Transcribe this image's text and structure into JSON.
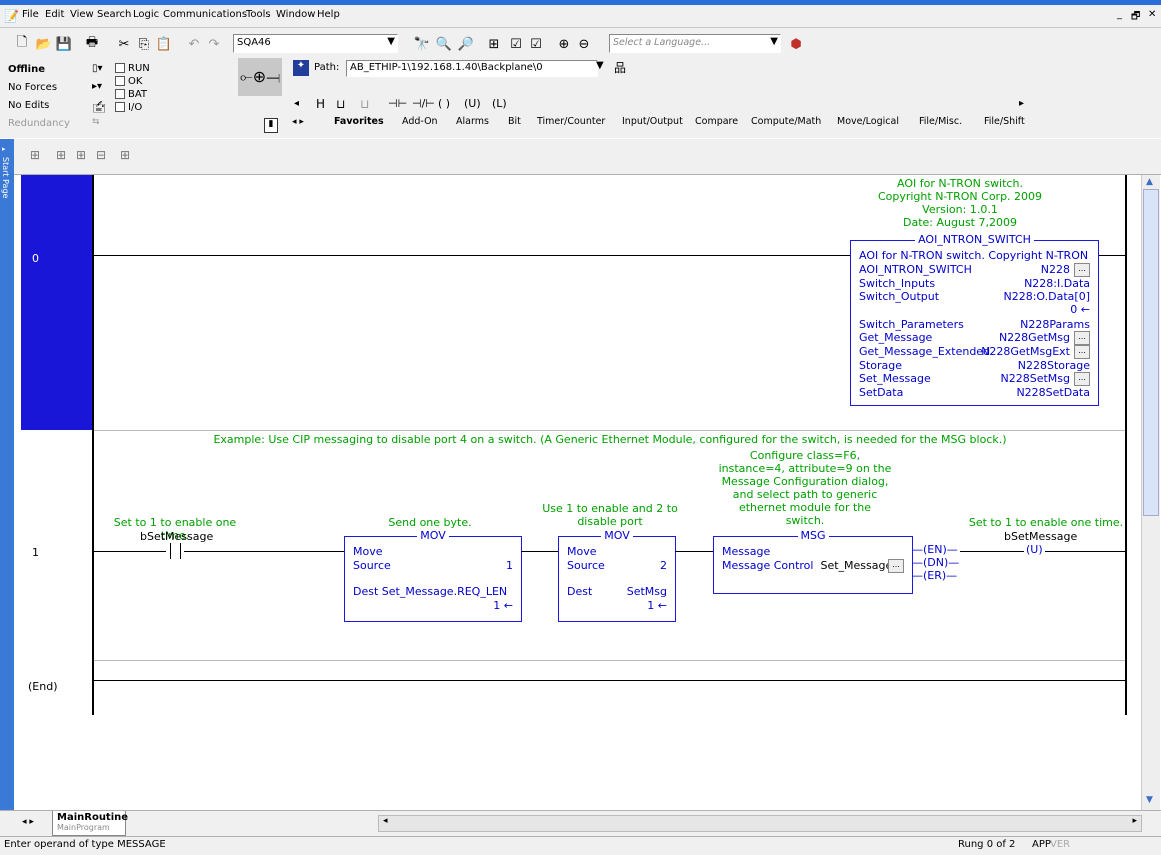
{
  "menu": [
    "File",
    "Edit",
    "View",
    "Search",
    "Logic",
    "Communications",
    "Tools",
    "Window",
    "Help"
  ],
  "window_controls": [
    "_",
    "🗗",
    "✕"
  ],
  "toolbar": {
    "project_field": "SQA46",
    "language_placeholder": "Select a Language..."
  },
  "controller_status": {
    "mode": "Offline",
    "forces": "No Forces",
    "edits": "No Edits",
    "redundancy": "Redundancy",
    "leds": [
      "RUN",
      "OK",
      "BAT",
      "I/O"
    ]
  },
  "path": {
    "label": "Path:",
    "value": "AB_ETHIP-1\\192.168.1.40\\Backplane\\0"
  },
  "instruction_tabs": [
    "Favorites",
    "Add-On",
    "Alarms",
    "Bit",
    "Timer/Counter",
    "Input/Output",
    "Compare",
    "Compute/Math",
    "Move/Logical",
    "File/Misc.",
    "File/Shift"
  ],
  "side_tab": "Start Page",
  "ladder": {
    "rung0": {
      "number": "0",
      "comment": [
        "AOI for N-TRON switch.",
        "Copyright N-TRON Corp. 2009",
        "Version: 1.0.1",
        "Date: August 7,2009"
      ],
      "aoi": {
        "title": "AOI_NTRON_SWITCH",
        "description": "AOI for N-TRON switch. Copyright N-TRON C...",
        "params": [
          {
            "name": "AOI_NTRON_SWITCH",
            "value": "N228"
          },
          {
            "name": "Switch_Inputs",
            "value": "N228:I.Data"
          },
          {
            "name": "Switch_Output",
            "value": "N228:O.Data[0]"
          },
          {
            "name": "",
            "value": "0 ←"
          },
          {
            "name": "Switch_Parameters",
            "value": "N228Params"
          },
          {
            "name": "Get_Message",
            "value": "N228GetMsg"
          },
          {
            "name": "Get_Message_Extended",
            "value": "N228GetMsgExt"
          },
          {
            "name": "Storage",
            "value": "N228Storage"
          },
          {
            "name": "Set_Message",
            "value": "N228SetMsg"
          },
          {
            "name": "SetData",
            "value": "N228SetData"
          }
        ]
      }
    },
    "rung1": {
      "number": "1",
      "comment": "Example: Use CIP messaging to disable port 4 on a switch. (A Generic Ethernet Module, configured for the switch, is needed for the MSG block.)",
      "xic_comment": "Set to 1 to enable one time.",
      "xic_tag": "bSetMessage",
      "mov1": {
        "comment": "Send one byte.",
        "title": "MOV",
        "op": "Move",
        "src_label": "Source",
        "src_value": "1",
        "dest_label": "Dest",
        "dest_value": "Set_Message.REQ_LEN",
        "dest_live": "1 ←"
      },
      "mov2": {
        "comment": [
          "Use 1 to enable and 2 to",
          "disable port"
        ],
        "title": "MOV",
        "op": "Move",
        "src_label": "Source",
        "src_value": "2",
        "dest_label": "Dest",
        "dest_value": "SetMsg",
        "dest_live": "1 ←"
      },
      "msg": {
        "comment": [
          "Configure class=F6,",
          "instance=4, attribute=9 on the",
          "Message Configuration dialog,",
          "and select path to generic",
          "ethernet module for the",
          "switch."
        ],
        "title": "MSG",
        "op": "Message",
        "ctrl_label": "Message Control",
        "ctrl_value": "Set_Message",
        "en": "EN",
        "dn": "DN",
        "er": "ER"
      },
      "otu_comment": "Set to 1 to enable one time.",
      "otu_tag": "bSetMessage",
      "otu_symbol": "U"
    },
    "end_label": "(End)"
  },
  "bottom_tab": {
    "routine": "MainRoutine",
    "program": "MainProgram"
  },
  "statusbar": {
    "message": "Enter operand of type MESSAGE",
    "rung": "Rung 0 of 2",
    "app": "APP",
    "ver": "VER"
  },
  "colors": {
    "rung_select": "#1a16d8",
    "instruction": "#0000cc",
    "comment": "#00a000"
  }
}
